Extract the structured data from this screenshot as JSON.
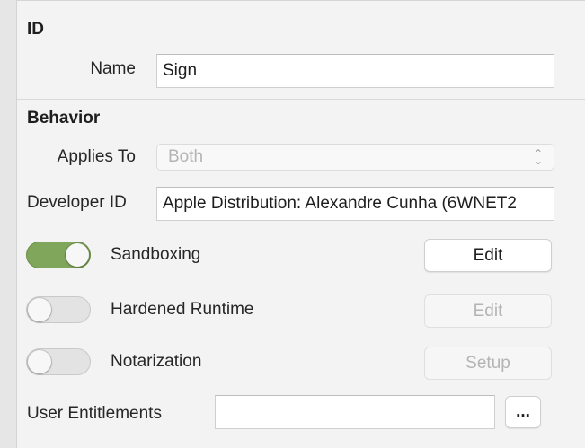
{
  "id_section": {
    "title": "ID",
    "name_label": "Name",
    "name_value": "Sign"
  },
  "behavior_section": {
    "title": "Behavior",
    "applies_to_label": "Applies To",
    "applies_to_value": "Both",
    "developer_id_label": "Developer ID",
    "developer_id_value": "Apple Distribution: Alexandre Cunha (6WNET2",
    "sandboxing": {
      "label": "Sandboxing",
      "enabled": true,
      "button_label": "Edit"
    },
    "hardened_runtime": {
      "label": "Hardened Runtime",
      "enabled": false,
      "button_label": "Edit"
    },
    "notarization": {
      "label": "Notarization",
      "enabled": false,
      "button_label": "Setup"
    },
    "user_entitlements_label": "User Entitlements",
    "user_entitlements_value": "",
    "more_button_label": "..."
  },
  "colors": {
    "toggle_on": "#7fa65a",
    "toggle_off": "#e3e3e3"
  }
}
